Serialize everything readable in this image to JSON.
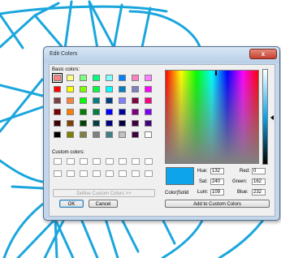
{
  "dialog": {
    "title": "Edit Colors",
    "close_label": "x",
    "basic_colors_label": "Basic colors:",
    "custom_colors_label": "Custom colors:",
    "define_custom_button": "Define Custom Colors >>",
    "ok_button": "OK",
    "cancel_button": "Cancel",
    "color_solid_label": "Color|Solid",
    "add_custom_button": "Add to Custom Colors",
    "fields": {
      "hue_label": "Hue:",
      "hue_value": "132",
      "sat_label": "Sat:",
      "sat_value": "240",
      "lum_label": "Lum:",
      "lum_value": "109",
      "red_label": "Red:",
      "red_value": "0",
      "green_label": "Green:",
      "green_value": "162",
      "blue_label": "Blue:",
      "blue_value": "232"
    },
    "selected_color": "#0da4eb",
    "basic_colors": [
      "#ff8080",
      "#ffff80",
      "#80ff80",
      "#00ff80",
      "#80ffff",
      "#0080ff",
      "#ff80c0",
      "#ff80ff",
      "#ff0000",
      "#ffff00",
      "#80ff00",
      "#00ff40",
      "#00ffff",
      "#0080c0",
      "#8080c0",
      "#ff00ff",
      "#804040",
      "#ff8040",
      "#00ff00",
      "#008080",
      "#004080",
      "#8080ff",
      "#800040",
      "#ff0080",
      "#800000",
      "#ff8000",
      "#008000",
      "#008040",
      "#0000ff",
      "#0000a0",
      "#800080",
      "#8000ff",
      "#400000",
      "#804000",
      "#004000",
      "#004040",
      "#000080",
      "#000040",
      "#400040",
      "#400080",
      "#000000",
      "#808000",
      "#808040",
      "#808080",
      "#408080",
      "#c0c0c0",
      "#400040",
      "#ffffff"
    ],
    "custom_colors_count": 16
  }
}
